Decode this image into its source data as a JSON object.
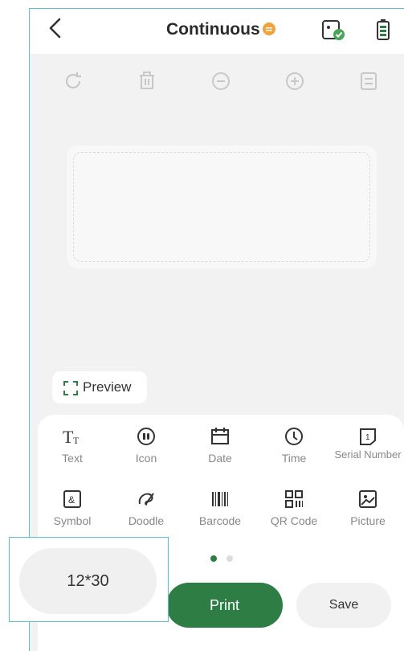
{
  "header": {
    "title": "Continuous",
    "badge": "◉"
  },
  "toolbar": {
    "icons": [
      "rotate-icon",
      "delete-icon",
      "zoom-out-icon",
      "zoom-in-icon",
      "align-icon"
    ]
  },
  "preview": {
    "label": "Preview"
  },
  "elements": {
    "row1": [
      {
        "label": "Text",
        "icon": "text-icon"
      },
      {
        "label": "Icon",
        "icon": "icon-icon"
      },
      {
        "label": "Date",
        "icon": "date-icon"
      },
      {
        "label": "Time",
        "icon": "time-icon"
      },
      {
        "label": "Serial Number",
        "icon": "serial-number-icon"
      }
    ],
    "row2": [
      {
        "label": "Symbol",
        "icon": "symbol-icon"
      },
      {
        "label": "Doodle",
        "icon": "doodle-icon"
      },
      {
        "label": "Barcode",
        "icon": "barcode-icon"
      },
      {
        "label": "QR Code",
        "icon": "qr-code-icon"
      },
      {
        "label": "Picture",
        "icon": "picture-icon"
      }
    ]
  },
  "actions": {
    "print_label": "Print",
    "save_label": "Save"
  },
  "size": {
    "value": "12*30"
  },
  "colors": {
    "accent": "#2e7d45",
    "badge": "#f0a23b",
    "highlight_frame": "#5bc0d3"
  }
}
